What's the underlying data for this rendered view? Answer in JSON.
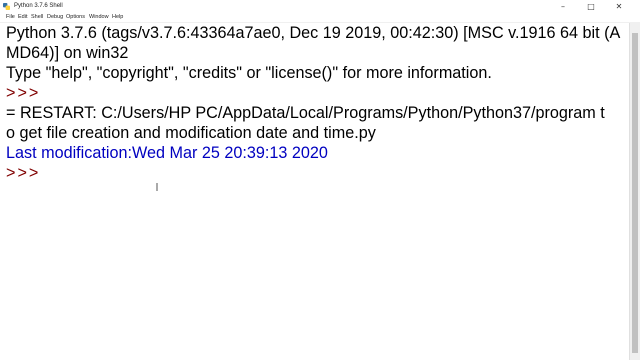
{
  "window": {
    "title": "Python 3.7.6 Shell",
    "controls": {
      "minimize": "–",
      "maximize": "□",
      "close": "✕"
    }
  },
  "menu": {
    "items": [
      "File",
      "Edit",
      "Shell",
      "Debug",
      "Options",
      "Window",
      "Help"
    ]
  },
  "console": {
    "lines": [
      "Python 3.7.6 (tags/v3.7.6:43364a7ae0, Dec 19 2019, 00:42:30) [MSC v.1916 64 bit (A",
      "MD64)] on win32",
      "Type \"help\", \"copyright\", \"credits\" or \"license()\" for more information.",
      ">>>",
      "= RESTART: C:/Users/HP PC/AppData/Local/Programs/Python/Python37/program t",
      "o get file creation and modification date and time.py",
      "Last modification:Wed Mar 25 20:39:13 2020",
      ">>>"
    ]
  },
  "colors": {
    "output_text": "#0000c0",
    "prompt": "#800000",
    "default_text": "#000000"
  },
  "icons": {
    "app": "python-idle-icon",
    "cursor": "text-ibeam-cursor"
  }
}
